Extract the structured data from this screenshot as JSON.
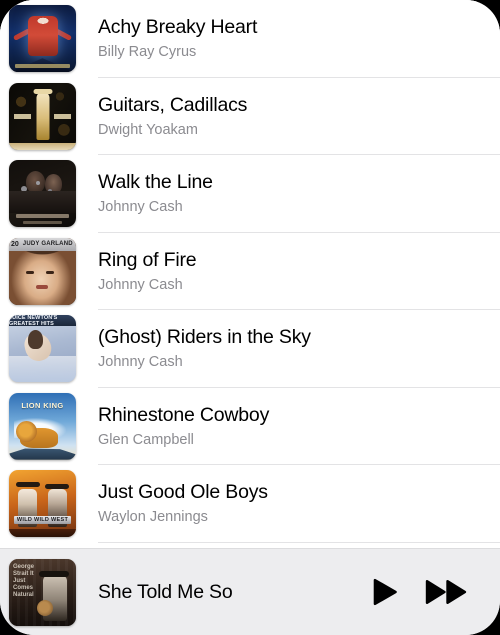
{
  "app": {
    "type": "music-player-song-list"
  },
  "songs": [
    {
      "title": "Achy Breaky Heart",
      "artist": "Billy Ray Cyrus",
      "art": "christmas-vacation-cover"
    },
    {
      "title": "Guitars, Cadillacs",
      "artist": "Dwight Yoakam",
      "art": "dwight-yoakam-cover"
    },
    {
      "title": "Walk the Line",
      "artist": "Johnny Cash",
      "art": "johnny-cash-live-cover"
    },
    {
      "title": "Ring of Fire",
      "artist": "Johnny Cash",
      "art": "judy-garland-cover"
    },
    {
      "title": "(Ghost) Riders in the Sky",
      "artist": "Johnny Cash",
      "art": "juice-newton-greatest-hits-cover"
    },
    {
      "title": "Rhinestone Cowboy",
      "artist": "Glen Campbell",
      "art": "lion-king-cover"
    },
    {
      "title": "Just Good Ole Boys",
      "artist": "Waylon Jennings",
      "art": "wild-wild-west-cover"
    }
  ],
  "now_playing": {
    "title": "She Told Me So",
    "art": "george-strait-cover",
    "play_label": "▶",
    "next_label": "▶▶"
  },
  "art_text": {
    "judy_num": "20",
    "judy_name": "JUDY GARLAND",
    "juice_title": "JUICE NEWTON'S GREATEST HITS",
    "lion_title": "LION KING",
    "west_title": "WILD WILD WEST",
    "strait_title": "George Strait It Just Comes Natural"
  },
  "colors": {
    "background": "#ffffff",
    "separator": "#e3e3e5",
    "title_text": "#000000",
    "artist_text": "#8b8b90",
    "nowplaying_background": "#ededef",
    "control_icon": "#000000"
  }
}
